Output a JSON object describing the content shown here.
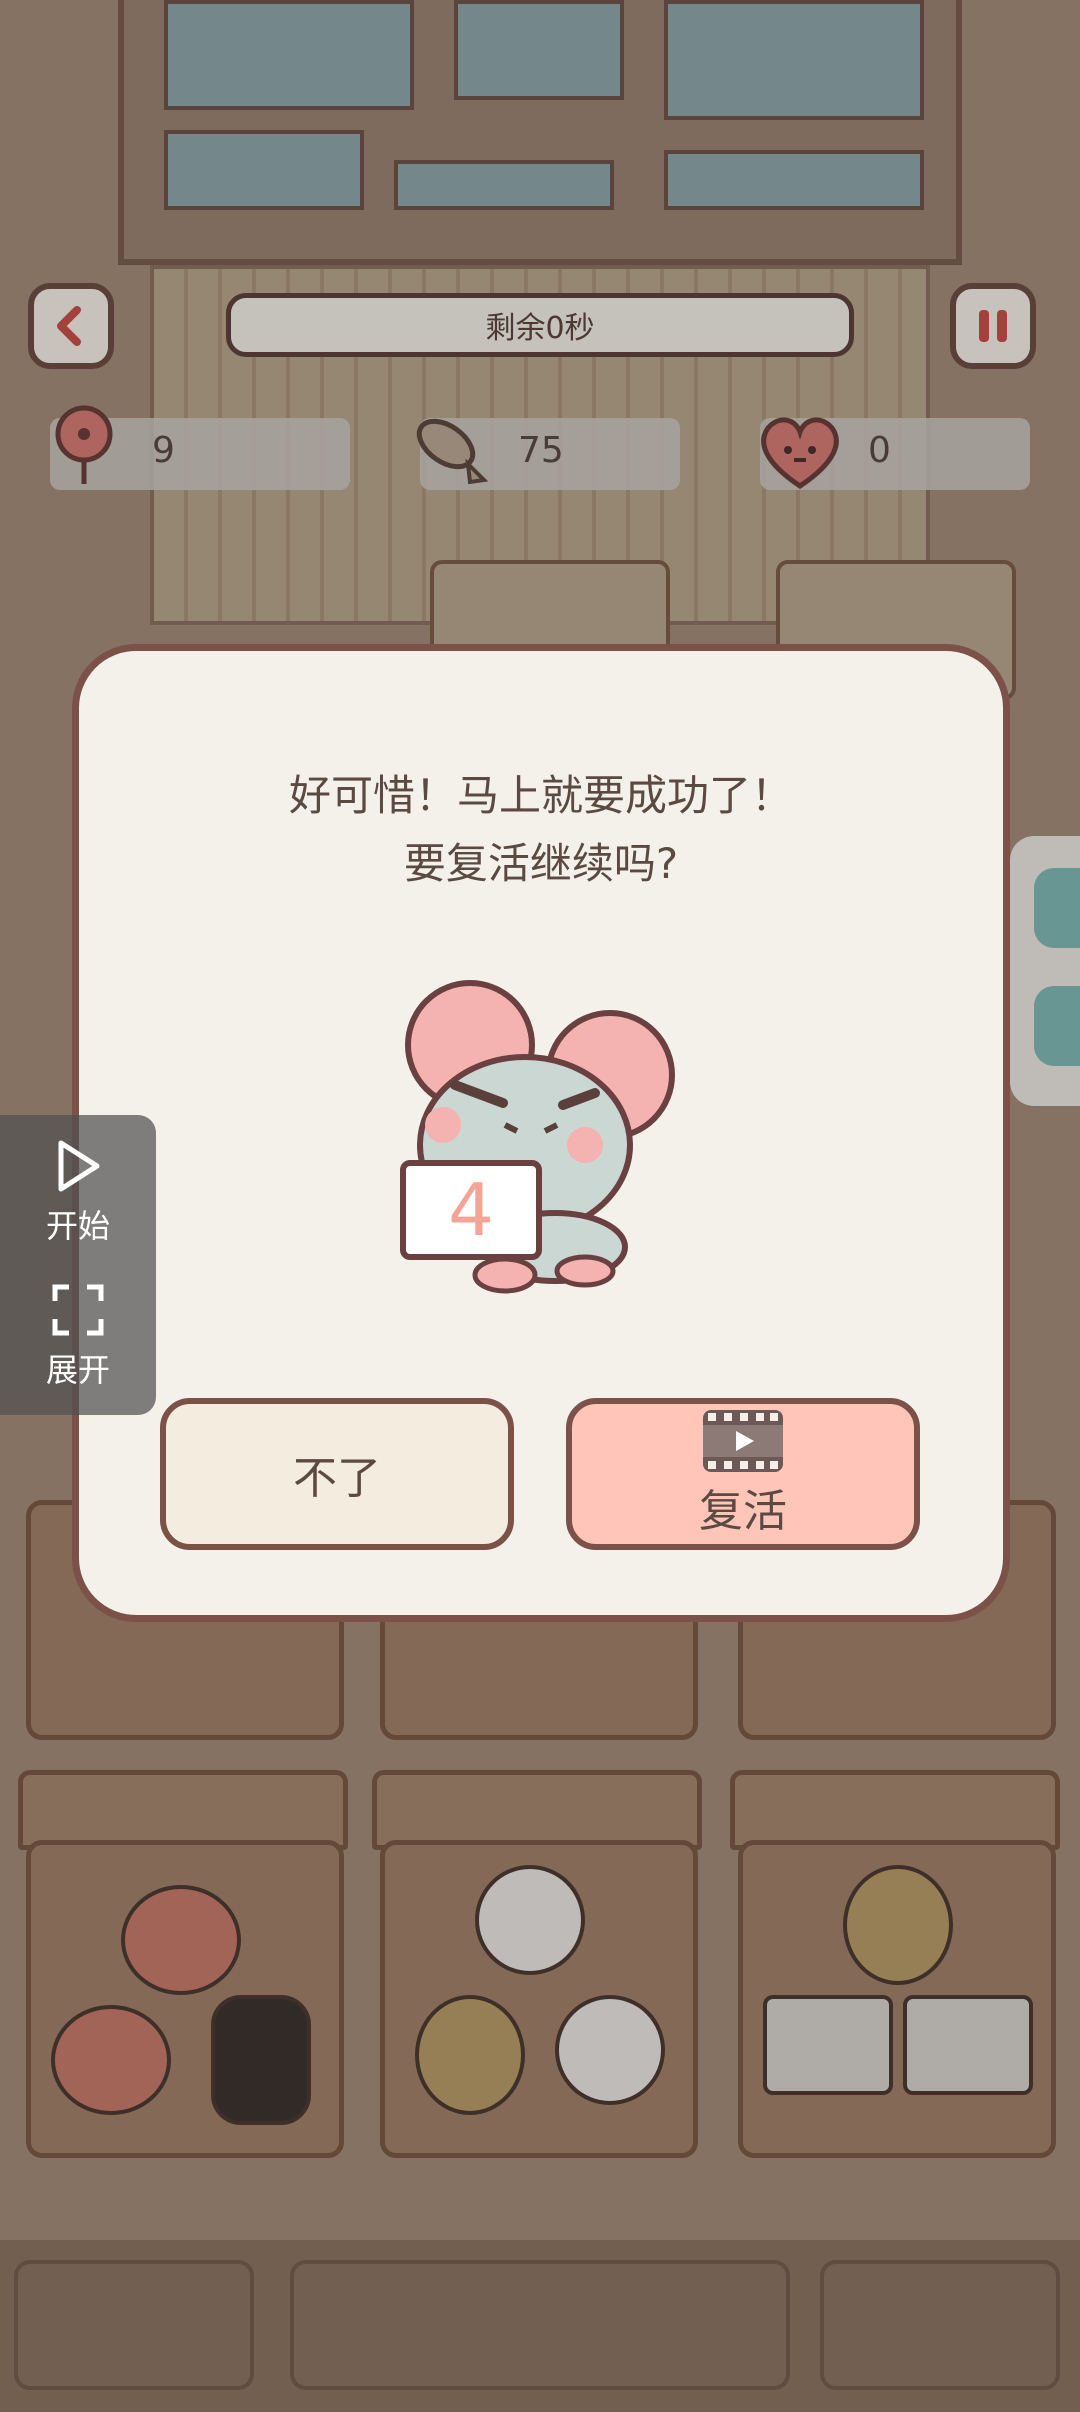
{
  "hud": {
    "timer_text": "剩余0秒",
    "stats": [
      {
        "icon": "flower-icon",
        "value": "9"
      },
      {
        "icon": "fish-icon",
        "value": "75"
      },
      {
        "icon": "heart-face-icon",
        "value": "0"
      }
    ]
  },
  "dialog": {
    "line1": "好可惜！马上就要成功了！",
    "line2": "要复活继续吗?",
    "countdown": "4",
    "decline_label": "不了",
    "revive_label": "复活"
  },
  "side_tool": {
    "start_label": "开始",
    "expand_label": "展开"
  },
  "colors": {
    "revive_button": "#ffc5b8",
    "decline_button": "#f4ecdf",
    "dialog_bg": "#f4f1ea",
    "dialog_border": "#7b5148",
    "countdown_digit": "#f2a496"
  }
}
